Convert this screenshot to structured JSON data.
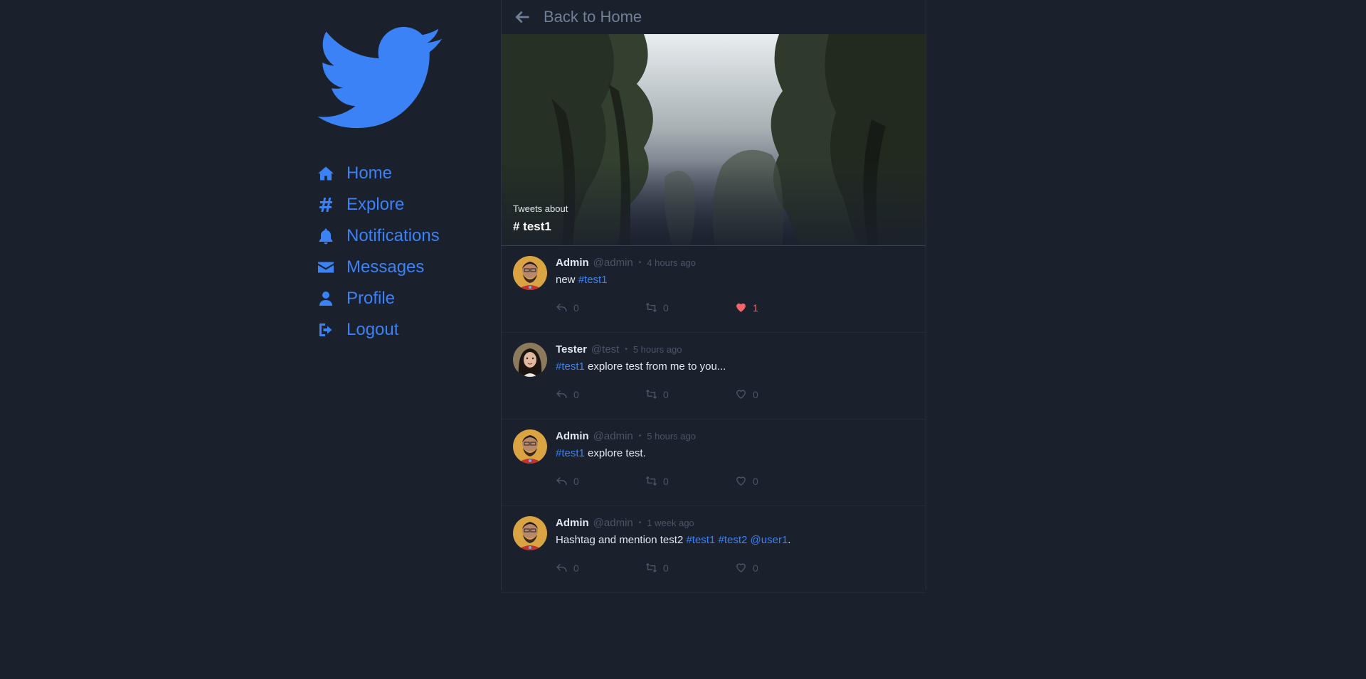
{
  "nav": {
    "items": [
      {
        "label": "Home",
        "icon": "home-icon"
      },
      {
        "label": "Explore",
        "icon": "hashtag-icon"
      },
      {
        "label": "Notifications",
        "icon": "bell-icon"
      },
      {
        "label": "Messages",
        "icon": "envelope-icon"
      },
      {
        "label": "Profile",
        "icon": "user-icon"
      },
      {
        "label": "Logout",
        "icon": "logout-icon"
      }
    ]
  },
  "header": {
    "back_label": "Back to Home",
    "back_icon": "arrow-left-icon"
  },
  "banner": {
    "caption": "Tweets about",
    "tag": "# test1"
  },
  "colors": {
    "accent": "#3b82f6",
    "background": "#1a202c",
    "like": "#f56565",
    "muted": "#4a5568"
  },
  "tweets": [
    {
      "name": "Admin",
      "handle": "@admin",
      "dot": "•",
      "time": "4 hours ago",
      "text_before": "new ",
      "tag1": "#test1",
      "text_after": "",
      "replies": "0",
      "retweets": "0",
      "likes": "1",
      "liked": true
    },
    {
      "name": "Tester",
      "handle": "@test",
      "dot": "•",
      "time": "5 hours ago",
      "tag1": "#test1",
      "text_after": " explore test from me to you...",
      "replies": "0",
      "retweets": "0",
      "likes": "0",
      "liked": false
    },
    {
      "name": "Admin",
      "handle": "@admin",
      "dot": "•",
      "time": "5 hours ago",
      "tag1": "#test1",
      "text_after": " explore test.",
      "replies": "0",
      "retweets": "0",
      "likes": "0",
      "liked": false
    },
    {
      "name": "Admin",
      "handle": "@admin",
      "dot": "•",
      "time": "1 week ago",
      "text_before": "Hashtag and mention test2 ",
      "tag1": "#test1",
      "sep1": " ",
      "tag2": "#test2",
      "sep2": " ",
      "mention": "@user1",
      "text_after": ".",
      "replies": "0",
      "retweets": "0",
      "likes": "0",
      "liked": false
    }
  ]
}
